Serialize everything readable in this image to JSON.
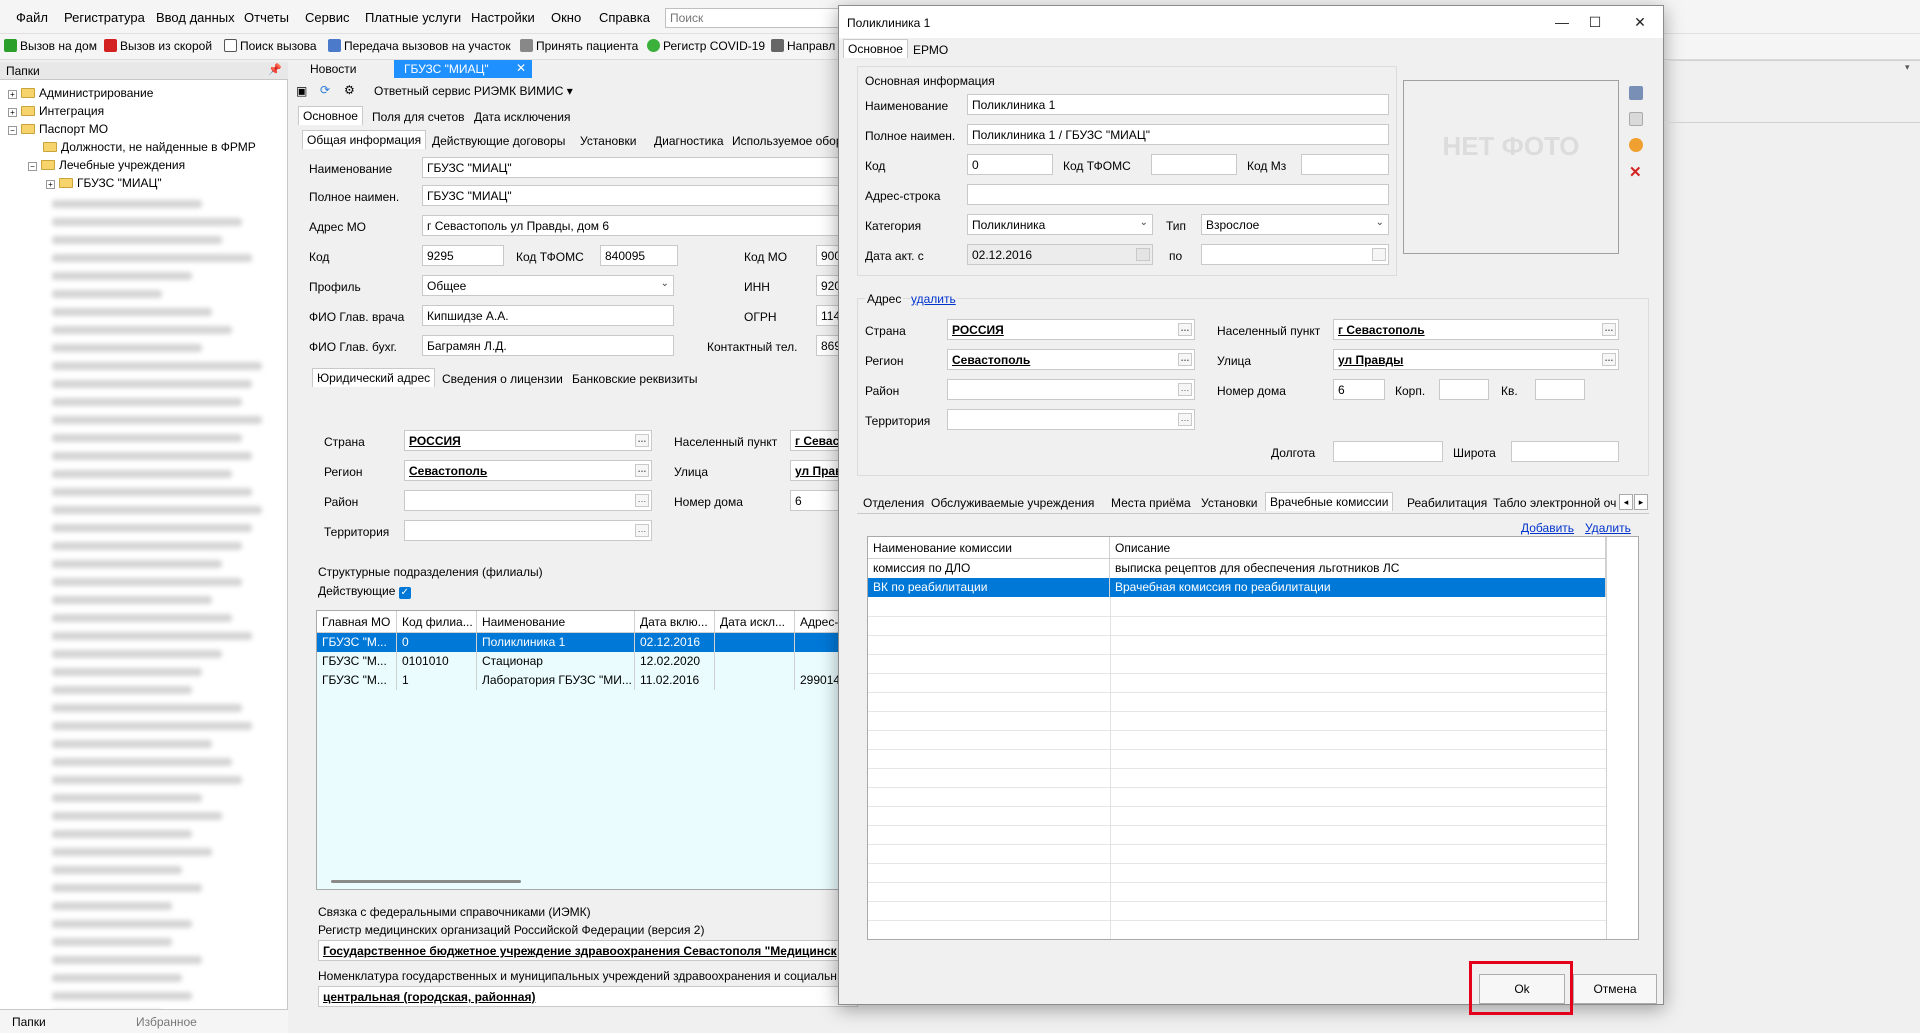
{
  "menu": [
    "Файл",
    "Регистратура",
    "Ввод данных",
    "Отчеты",
    "Сервис",
    "Платные услуги",
    "Настройки",
    "Окно",
    "Справка"
  ],
  "search": {
    "placeholder": "Поиск"
  },
  "toolbar": [
    "Вызов на дом",
    "Вызов из скорой",
    "Поиск вызова",
    "Передача вызовов на участок",
    "Принять пациента",
    "Регистр COVID-19",
    "Направл"
  ],
  "folders": {
    "title": "Папки",
    "tree": [
      "Администрирование",
      "Интеграция",
      "Паспорт МО",
      "Должности, не найденные в ФРМР",
      "Лечебные учреждения",
      "ГБУЗС \"МИАЦ\""
    ],
    "bottom_tabs": [
      "Папки",
      "Избранное"
    ]
  },
  "doc_tabs": [
    "Новости",
    "ГБУЗС \"МИАЦ\""
  ],
  "main": {
    "service": "Ответный сервис РИЭМК ВИМИС",
    "tabs": [
      "Основное",
      "Поля для счетов",
      "Дата исключения"
    ],
    "subtabs": [
      "Общая информация",
      "Действующие договоры",
      "Установки",
      "Диагностика",
      "Используемое обор"
    ],
    "fields": {
      "name_label": "Наименование",
      "name": "ГБУЗС \"МИАЦ\"",
      "fullname_label": "Полное наимен.",
      "fullname": "ГБУЗС \"МИАЦ\"",
      "addr_label": "Адрес МО",
      "addr": "г Севастополь  ул Правды, дом 6",
      "code_label": "Код",
      "code": "9295",
      "tfoms_label": "Код ТФОМС",
      "tfoms": "840095",
      "codemo_label": "Код МО",
      "codemo": "900",
      "inn_label": "ИНН",
      "inn": "920",
      "ogrn_label": "ОГРН",
      "ogrn": "114",
      "tel_label": "Контактный тел.",
      "tel": "869",
      "profile_label": "Профиль",
      "profile": "Общее",
      "chief_label": "ФИО Глав. врача",
      "chief": "Кипшидзе А.А.",
      "acct_label": "ФИО Глав. бухг.",
      "acct": "Баграмян Л.Д."
    },
    "addr_tabs": [
      "Юридический адрес",
      "Сведения о лицензии",
      "Банковские реквизиты"
    ],
    "addr": {
      "country_label": "Страна",
      "country": "РОССИЯ",
      "region_label": "Регион",
      "region": "Севастополь",
      "district_label": "Район",
      "territory_label": "Территория",
      "city_label": "Населенный пункт",
      "city": "г Севас",
      "street_label": "Улица",
      "street": "ул Прав",
      "house_label": "Номер дома",
      "house": "6"
    },
    "branches": {
      "title": "Структурные подразделения (филиалы)",
      "active_label": "Действующие",
      "columns": [
        "Главная МО",
        "Код филиа...",
        "Наименование",
        "Дата вклю...",
        "Дата искл...",
        "Адрес-..."
      ],
      "rows": [
        [
          "ГБУЗС \"М...",
          "0",
          "Поликлиника 1",
          "02.12.2016",
          "",
          ""
        ],
        [
          "ГБУЗС \"М...",
          "0101010",
          "Стационар",
          "12.02.2020",
          "",
          ""
        ],
        [
          "ГБУЗС \"М...",
          "1",
          "Лаборатория ГБУЗС \"МИ...",
          "11.02.2016",
          "",
          "299014,"
        ]
      ]
    },
    "fed": {
      "title": "Связка с федеральными справочниками (ИЭМК)",
      "reg_label": "Регистр медицинских организаций Российской Федерации (версия 2)",
      "reg_value": "Государственное бюджетное учреждение здравоохранения Севастополя \"Медицинск",
      "nom_label": "Номенклатура государственных и муниципальных учреждений здравоохранения и социальн",
      "nom_value": "центральная (городская, районная)"
    }
  },
  "dialog": {
    "title": "Поликлиника 1",
    "tabs": [
      "Основное",
      "ЕРМО"
    ],
    "basic_title": "Основная информация",
    "name_label": "Наименование",
    "name": "Поликлиника 1",
    "fullname_label": "Полное наимен.",
    "fullname": "Поликлиника 1 / ГБУЗС \"МИАЦ\"",
    "code_label": "Код",
    "code": "0",
    "tfoms_label": "Код ТФОМС",
    "tfoms": "",
    "ms_label": "Код Мз",
    "ms": "",
    "addrstr_label": "Адрес-строка",
    "addrstr": "",
    "cat_label": "Категория",
    "cat": "Поликлиника",
    "type_label": "Тип",
    "type": "Взрослое",
    "date_label": "Дата акт. с",
    "date": "02.12.2016",
    "to_label": "по",
    "to": "",
    "photo": "НЕТ ФОТО",
    "address_title": "Адрес",
    "address_delete": "удалить",
    "country_label": "Страна",
    "country": "РОССИЯ",
    "region_label": "Регион",
    "region": "Севастополь",
    "district_label": "Район",
    "territory_label": "Территория",
    "city_label": "Населенный пункт",
    "city": "г Севастополь",
    "street_label": "Улица",
    "street": "ул Правды",
    "house_label": "Номер дома",
    "house": "6",
    "korp_label": "Корп.",
    "kv_label": "Кв.",
    "lon_label": "Долгота",
    "lat_label": "Широта",
    "sub_tabs": [
      "Отделения",
      "Обслуживаемые учреждения",
      "Места приёма",
      "Установки",
      "Врачебные комиссии",
      "Реабилитация",
      "Табло электронной оч"
    ],
    "add_link": "Добавить",
    "del_link": "Удалить",
    "commission_columns": [
      "Наименование комиссии",
      "Описание"
    ],
    "commission_rows": [
      [
        "комиссия по ДЛО",
        "выписка рецептов для обеспечения льготников ЛС"
      ],
      [
        "ВК по реабилитации",
        "Врачебная комиссия по реабилитации"
      ]
    ],
    "ok": "Ok",
    "cancel": "Отмена"
  },
  "colors": {
    "selection": "#0078d7",
    "highlight": "#e4001b",
    "link": "#0033cc"
  }
}
